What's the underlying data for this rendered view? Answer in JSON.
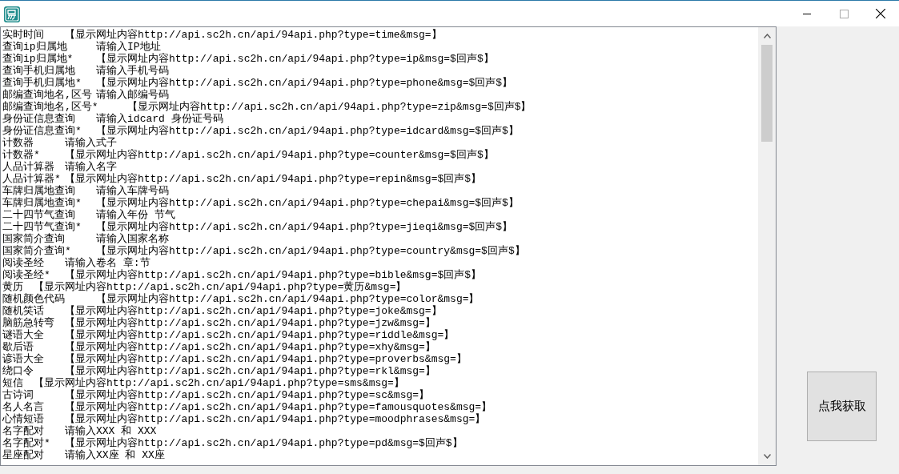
{
  "text_area": {
    "lines": [
      "实时时间\t【显示网址内容http://api.sc2h.cn/api/94api.php?type=time&msg=】",
      "查询ip归属地\t请输入IP地址",
      "查询ip归属地*\t【显示网址内容http://api.sc2h.cn/api/94api.php?type=ip&msg=$回声$】",
      "查询手机归属地\t请输入手机号码",
      "查询手机归属地*\t【显示网址内容http://api.sc2h.cn/api/94api.php?type=phone&msg=$回声$】",
      "邮编查询地名,区号\t请输入邮编号码",
      "邮编查询地名,区号*\t【显示网址内容http://api.sc2h.cn/api/94api.php?type=zip&msg=$回声$】",
      "身份证信息查询\t请输入idcard 身份证号码",
      "身份证信息查询*\t【显示网址内容http://api.sc2h.cn/api/94api.php?type=idcard&msg=$回声$】",
      "计数器\t请输入式子",
      "计数器*\t【显示网址内容http://api.sc2h.cn/api/94api.php?type=counter&msg=$回声$】",
      "人品计算器\t请输入名字",
      "人品计算器*\t【显示网址内容http://api.sc2h.cn/api/94api.php?type=repin&msg=$回声$】",
      "车牌归属地查询\t请输入车牌号码",
      "车牌归属地查询*\t【显示网址内容http://api.sc2h.cn/api/94api.php?type=chepai&msg=$回声$】",
      "二十四节气查询\t请输入年份 节气",
      "二十四节气查询*\t【显示网址内容http://api.sc2h.cn/api/94api.php?type=jieqi&msg=$回声$】",
      "国家简介查询\t请输入国家名称",
      "国家简介查询*\t【显示网址内容http://api.sc2h.cn/api/94api.php?type=country&msg=$回声$】",
      "阅读圣经\t请输入卷名 章:节",
      "阅读圣经*\t【显示网址内容http://api.sc2h.cn/api/94api.php?type=bible&msg=$回声$】",
      "黄历\t【显示网址内容http://api.sc2h.cn/api/94api.php?type=黄历&msg=】",
      "随机颜色代码\t【显示网址内容http://api.sc2h.cn/api/94api.php?type=color&msg=】",
      "随机笑话\t【显示网址内容http://api.sc2h.cn/api/94api.php?type=joke&msg=】",
      "脑筋急转弯\t【显示网址内容http://api.sc2h.cn/api/94api.php?type=jzw&msg=】",
      "谜语大全\t【显示网址内容http://api.sc2h.cn/api/94api.php?type=riddle&msg=】",
      "歇后语\t【显示网址内容http://api.sc2h.cn/api/94api.php?type=xhy&msg=】",
      "谚语大全\t【显示网址内容http://api.sc2h.cn/api/94api.php?type=proverbs&msg=】",
      "绕口令\t【显示网址内容http://api.sc2h.cn/api/94api.php?type=rkl&msg=】",
      "短信\t【显示网址内容http://api.sc2h.cn/api/94api.php?type=sms&msg=】",
      "古诗词\t【显示网址内容http://api.sc2h.cn/api/94api.php?type=sc&msg=】",
      "名人名言\t【显示网址内容http://api.sc2h.cn/api/94api.php?type=famousquotes&msg=】",
      "心情短语\t【显示网址内容http://api.sc2h.cn/api/94api.php?type=moodphrases&msg=】",
      "名字配对\t请输入XXX 和 XXX",
      "名字配对*\t【显示网址内容http://api.sc2h.cn/api/94api.php?type=pd&msg=$回声$】",
      "星座配对\t请输入XX座 和 XX座"
    ]
  },
  "fetch_button": {
    "label": "点我获取"
  }
}
